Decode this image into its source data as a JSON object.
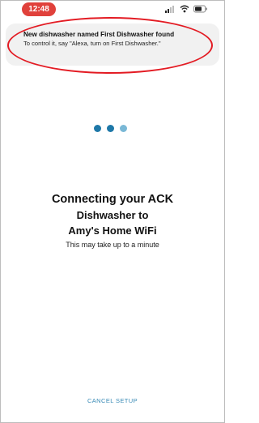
{
  "status_bar": {
    "time": "12:48",
    "time_pill_color": "#e0413b",
    "icons": [
      "signal-icon",
      "wifi-icon",
      "battery-icon"
    ]
  },
  "notification": {
    "title": "New dishwasher named First Dishwasher found",
    "body": "To control it, say \"Alexa, turn on First Dishwasher.\"",
    "highlight_color": "#e31b23"
  },
  "progress": {
    "dot_colors": [
      "#1e78a8",
      "#1e78a8",
      "#7ab8d6"
    ]
  },
  "main": {
    "heading_line1": "Connecting your ACK",
    "heading_line2": "Dishwasher to",
    "heading_line3": "Amy's Home WiFi",
    "subtext": "This may take up to a minute"
  },
  "footer": {
    "cancel_label": "CANCEL SETUP",
    "link_color": "#3a8bb6"
  }
}
